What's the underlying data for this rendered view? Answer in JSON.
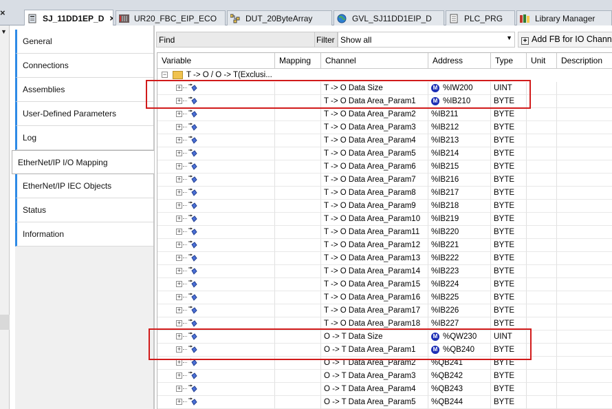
{
  "tabs": [
    {
      "label": "SJ_11DD1EP_D",
      "icon": "device-icon",
      "active": true
    },
    {
      "label": "UR20_FBC_EIP_ECO",
      "icon": "module-icon",
      "active": false
    },
    {
      "label": "DUT_20ByteArray",
      "icon": "dut-icon",
      "active": false
    },
    {
      "label": "GVL_SJ11DD1EIP_D",
      "icon": "globe-icon",
      "active": false
    },
    {
      "label": "PLC_PRG",
      "icon": "document-icon",
      "active": false
    },
    {
      "label": "Library Manager",
      "icon": "library-icon",
      "active": false
    }
  ],
  "nav": {
    "items": [
      {
        "label": "General"
      },
      {
        "label": "Connections"
      },
      {
        "label": "Assemblies"
      },
      {
        "label": "User-Defined Parameters"
      },
      {
        "label": "Log"
      },
      {
        "label": "EtherNet/IP I/O Mapping"
      },
      {
        "label": "EtherNet/IP IEC Objects"
      },
      {
        "label": "Status"
      },
      {
        "label": "Information"
      }
    ],
    "active_index": 5
  },
  "toolbar": {
    "find_label": "Find",
    "filter_label": "Filter",
    "filter_value": "Show all",
    "add_fb_label": "Add FB for IO Channel"
  },
  "grid": {
    "headers": {
      "variable": "Variable",
      "mapping": "Mapping",
      "channel": "Channel",
      "address": "Address",
      "type": "Type",
      "unit": "Unit",
      "description": "Description"
    },
    "folder_label": "T -> O / O -> T(Exclusi...",
    "rows": [
      {
        "channel": "T -> O Data Size",
        "address": "%IW200",
        "type": "UINT",
        "mapped": true
      },
      {
        "channel": "T -> O Data Area_Param1",
        "address": "%IB210",
        "type": "BYTE",
        "mapped": true
      },
      {
        "channel": "T -> O Data Area_Param2",
        "address": "%IB211",
        "type": "BYTE",
        "mapped": false
      },
      {
        "channel": "T -> O Data Area_Param3",
        "address": "%IB212",
        "type": "BYTE",
        "mapped": false
      },
      {
        "channel": "T -> O Data Area_Param4",
        "address": "%IB213",
        "type": "BYTE",
        "mapped": false
      },
      {
        "channel": "T -> O Data Area_Param5",
        "address": "%IB214",
        "type": "BYTE",
        "mapped": false
      },
      {
        "channel": "T -> O Data Area_Param6",
        "address": "%IB215",
        "type": "BYTE",
        "mapped": false
      },
      {
        "channel": "T -> O Data Area_Param7",
        "address": "%IB216",
        "type": "BYTE",
        "mapped": false
      },
      {
        "channel": "T -> O Data Area_Param8",
        "address": "%IB217",
        "type": "BYTE",
        "mapped": false
      },
      {
        "channel": "T -> O Data Area_Param9",
        "address": "%IB218",
        "type": "BYTE",
        "mapped": false
      },
      {
        "channel": "T -> O Data Area_Param10",
        "address": "%IB219",
        "type": "BYTE",
        "mapped": false
      },
      {
        "channel": "T -> O Data Area_Param11",
        "address": "%IB220",
        "type": "BYTE",
        "mapped": false
      },
      {
        "channel": "T -> O Data Area_Param12",
        "address": "%IB221",
        "type": "BYTE",
        "mapped": false
      },
      {
        "channel": "T -> O Data Area_Param13",
        "address": "%IB222",
        "type": "BYTE",
        "mapped": false
      },
      {
        "channel": "T -> O Data Area_Param14",
        "address": "%IB223",
        "type": "BYTE",
        "mapped": false
      },
      {
        "channel": "T -> O Data Area_Param15",
        "address": "%IB224",
        "type": "BYTE",
        "mapped": false
      },
      {
        "channel": "T -> O Data Area_Param16",
        "address": "%IB225",
        "type": "BYTE",
        "mapped": false
      },
      {
        "channel": "T -> O Data Area_Param17",
        "address": "%IB226",
        "type": "BYTE",
        "mapped": false
      },
      {
        "channel": "T -> O Data Area_Param18",
        "address": "%IB227",
        "type": "BYTE",
        "mapped": false
      },
      {
        "channel": "O -> T Data Size",
        "address": "%QW230",
        "type": "UINT",
        "mapped": true
      },
      {
        "channel": "O -> T Data Area_Param1",
        "address": "%QB240",
        "type": "BYTE",
        "mapped": true
      },
      {
        "channel": "O -> T Data Area_Param2",
        "address": "%QB241",
        "type": "BYTE",
        "mapped": false
      },
      {
        "channel": "O -> T Data Area_Param3",
        "address": "%QB242",
        "type": "BYTE",
        "mapped": false
      },
      {
        "channel": "O -> T Data Area_Param4",
        "address": "%QB243",
        "type": "BYTE",
        "mapped": false
      },
      {
        "channel": "O -> T Data Area_Param5",
        "address": "%QB244",
        "type": "BYTE",
        "mapped": false
      }
    ]
  },
  "mapped_badge": "M",
  "colors": {
    "highlight": "#d11a1a",
    "badge": "#1d2fb5",
    "nav_accent": "#2e8ae6"
  }
}
